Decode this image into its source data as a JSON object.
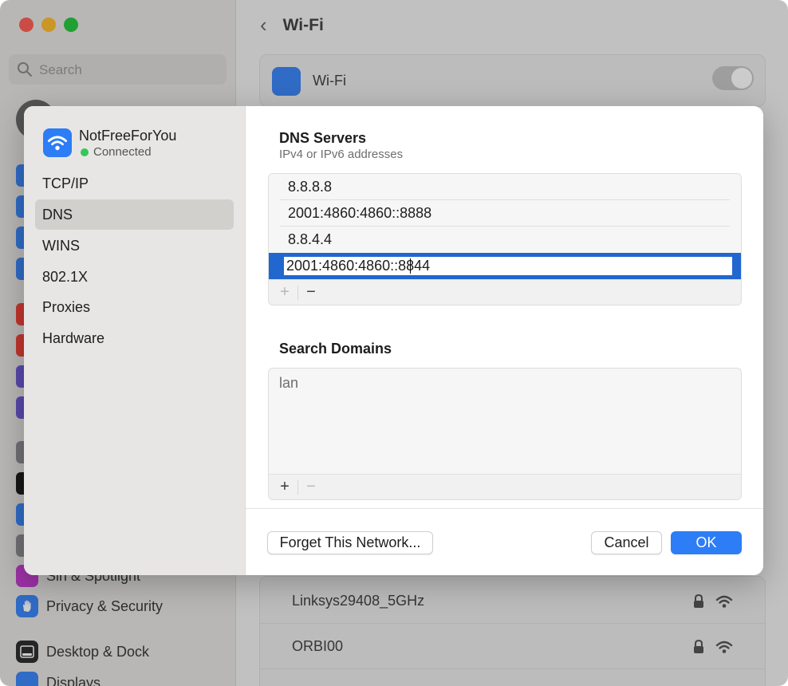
{
  "background": {
    "search_placeholder": "Search",
    "header_title": "Wi-Fi",
    "wifi_card_label": "Wi-Fi",
    "sidebar_items": [
      {
        "label": "Siri & Spotlight",
        "icon": "siri-icon"
      },
      {
        "label": "Privacy & Security",
        "icon": "hand-icon"
      },
      {
        "label": "Desktop & Dock",
        "icon": "dock-icon"
      },
      {
        "label": "Displays",
        "icon": "sun-icon"
      }
    ],
    "networks": [
      {
        "name": "Linksys29408_5GHz"
      },
      {
        "name": "ORBI00"
      }
    ]
  },
  "sheet": {
    "network_name": "NotFreeForYou",
    "network_status": "Connected",
    "status_color": "#34c759",
    "nav": [
      {
        "label": "TCP/IP",
        "selected": false
      },
      {
        "label": "DNS",
        "selected": true
      },
      {
        "label": "WINS",
        "selected": false
      },
      {
        "label": "802.1X",
        "selected": false
      },
      {
        "label": "Proxies",
        "selected": false
      },
      {
        "label": "Hardware",
        "selected": false
      }
    ],
    "dns": {
      "title": "DNS Servers",
      "subtitle": "IPv4 or IPv6 addresses",
      "servers": [
        "8.8.8.8",
        "2001:4860:4860::8888",
        "8.8.4.4",
        "2001:4860:4860::8844"
      ],
      "add_symbol": "+",
      "remove_symbol": "−"
    },
    "search_domains": {
      "title": "Search Domains",
      "entries": [
        "lan"
      ],
      "add_symbol": "+",
      "remove_symbol": "−"
    },
    "buttons": {
      "forget": "Forget This Network...",
      "cancel": "Cancel",
      "ok": "OK"
    },
    "accent_color": "#2d7df6"
  }
}
